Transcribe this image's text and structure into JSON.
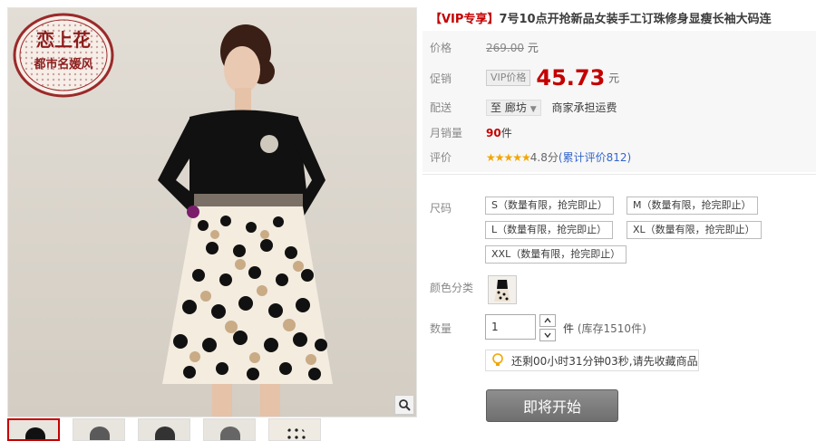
{
  "product": {
    "title_tag": "【VIP专享】",
    "title": "7号10点开抢新品女装手工订珠修身显瘦长袖大码连",
    "logo_text": {
      "brand": "恋上花",
      "slogan": "都市名媛风"
    }
  },
  "price": {
    "list_label": "价格",
    "list_price": "269.00",
    "currency_unit": "元",
    "promo_label": "促销",
    "vip_badge": "VIP价格",
    "promo_price": "45.73",
    "promo_unit": "元"
  },
  "shipping": {
    "label": "配送",
    "to_prefix": "至",
    "region": "廊坊",
    "note": "商家承担运费"
  },
  "sales": {
    "label": "月销量",
    "count": "90",
    "unit": "件"
  },
  "rating": {
    "label": "评价",
    "stars": "★★★★★",
    "score": "4.8分",
    "reviews": "(累计评价812)"
  },
  "sizes": {
    "label": "尺码",
    "options": [
      "S（数量有限，抢完即止）",
      "M（数量有限，抢完即止）",
      "L（数量有限，抢完即止）",
      "XL（数量有限，抢完即止）",
      "XXL（数量有限，抢完即止）"
    ]
  },
  "color": {
    "label": "颜色分类"
  },
  "quantity": {
    "label": "数量",
    "value": "1",
    "unit": "件",
    "stock": "(库存1510件)"
  },
  "countdown": {
    "text": "还剩00小时31分钟03秒,请先收藏商品"
  },
  "buy_button": {
    "label": "即将开始"
  },
  "colors": {
    "accent": "#c40000",
    "link": "#3366cc",
    "star": "#f2a600"
  }
}
